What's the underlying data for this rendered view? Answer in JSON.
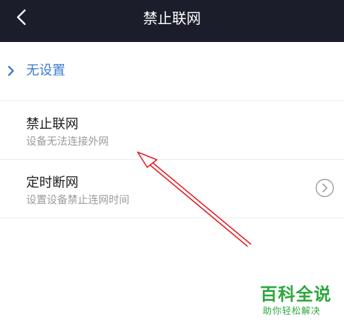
{
  "header": {
    "title": "禁止联网",
    "back_icon": "chevron-left-icon",
    "background": "#1b1d2b"
  },
  "options": {
    "none": {
      "label": "无设置",
      "selected": true,
      "indicator_icon": "chevron-right-icon",
      "color": "#3c7bd4"
    },
    "block": {
      "title": "禁止联网",
      "subtitle": "设备无法连接外网"
    },
    "timer": {
      "title": "定时断网",
      "subtitle": "设置设备禁止连网时间",
      "action_icon": "chevron-right-circle-icon"
    }
  },
  "annotation": {
    "icon": "red-arrow-icon",
    "color": "#e8141b"
  },
  "watermark": {
    "title": "百科全说",
    "subtitle": "助你轻松解决",
    "color": "#2ea73d"
  }
}
